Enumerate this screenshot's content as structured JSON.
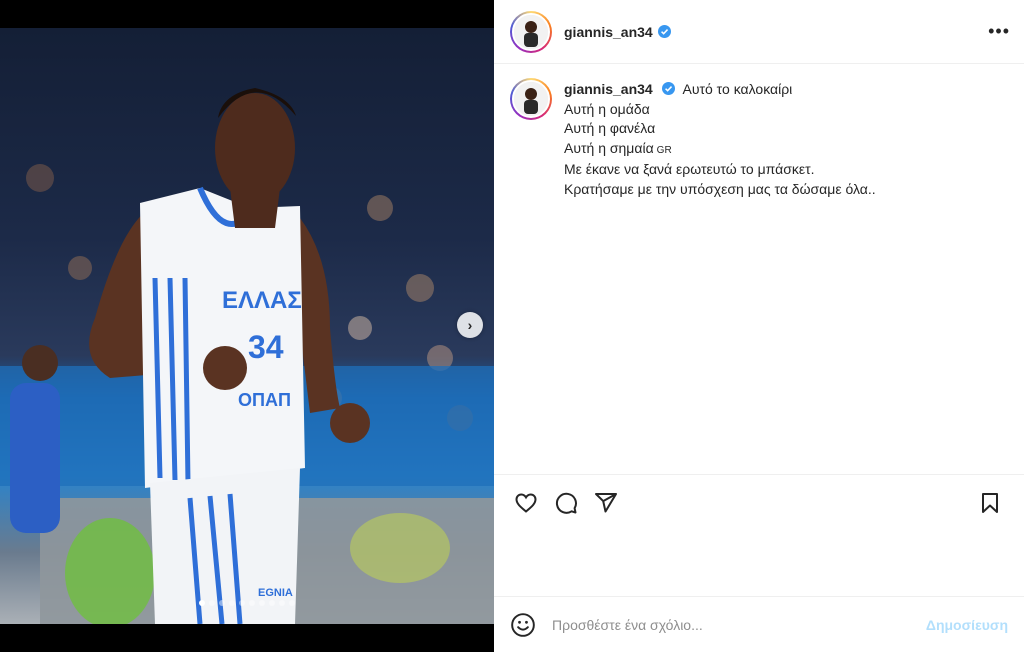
{
  "post": {
    "username": "giannis_an34",
    "more_label": "•••"
  },
  "caption": {
    "username": "giannis_an34",
    "first_line": "Αυτό το καλοκαίρι",
    "lines": [
      "Αυτή η ομάδα",
      "Αυτή η φανέλα",
      "Αυτή η σημαία",
      "Με έκανε να ξανά ερωτευτώ το μπάσκετ.",
      "Κρατήσαμε με την υπόσχεση μας τα δώσαμε όλα.."
    ],
    "flag_label": "GR"
  },
  "photo": {
    "jersey_text": "ΕΛΛΑΣ",
    "jersey_number": "34",
    "sponsor_text": "OΠΑΠ",
    "shorts_text": "EGNIA"
  },
  "carousel": {
    "slide_count": 10,
    "active_index": 0
  },
  "comment_box": {
    "placeholder": "Προσθέστε ένα σχόλιο...",
    "post_label": "Δημοσίευση"
  },
  "colors": {
    "verified": "#3897f0",
    "post_button_disabled": "#b2dffc"
  },
  "icons": [
    "verified-icon",
    "more-options-icon",
    "chevron-right-icon",
    "heart-icon",
    "comment-icon",
    "share-icon",
    "bookmark-icon",
    "emoji-icon"
  ]
}
